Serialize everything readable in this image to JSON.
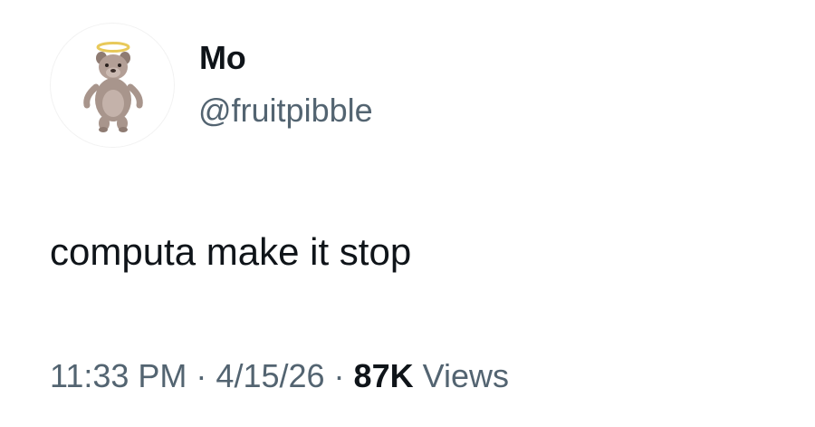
{
  "author": {
    "display_name": "Mo",
    "handle": "@fruitpibble",
    "avatar_icon": "pibble-dog-with-halo-avatar"
  },
  "tweet": {
    "text": "computa make it stop"
  },
  "meta": {
    "time": "11:33 PM",
    "separator": "·",
    "date": "4/15/26",
    "views_count": "87K",
    "views_label": "Views"
  },
  "colors": {
    "text_primary": "#0f1419",
    "text_secondary": "#536471",
    "halo": "#e8c95a",
    "dog_body": "#a8958c"
  }
}
